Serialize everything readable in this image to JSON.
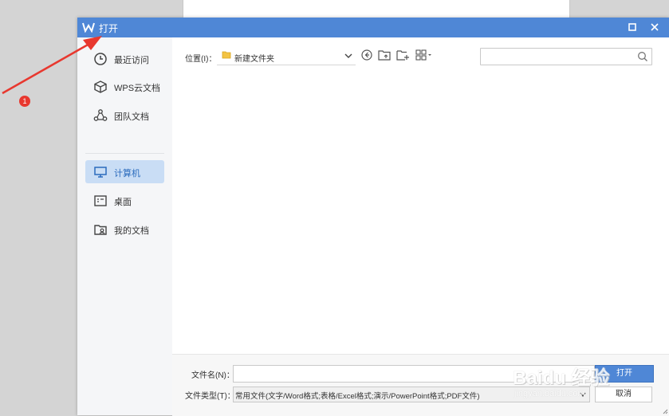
{
  "dialog": {
    "title": "打开",
    "title_icon": "wps-logo-icon",
    "buttons": {
      "maximize_icon": "maximize-icon",
      "close_icon": "close-icon"
    }
  },
  "sidebar": {
    "items": [
      {
        "label": "最近访问",
        "icon": "clock-icon",
        "active": false
      },
      {
        "label": "WPS云文档",
        "icon": "cloud-box-icon",
        "active": false
      },
      {
        "label": "团队文档",
        "icon": "team-icon",
        "active": false
      },
      {
        "label": "计算机",
        "icon": "computer-icon",
        "active": true
      },
      {
        "label": "桌面",
        "icon": "desktop-icon",
        "active": false
      },
      {
        "label": "我的文档",
        "icon": "my-documents-icon",
        "active": false
      }
    ]
  },
  "toolbar": {
    "location_label": "位置(I)：",
    "location_value": "新建文件夹",
    "tools": [
      "back-icon",
      "up-folder-icon",
      "new-folder-icon",
      "view-mode-icon"
    ],
    "search_placeholder": ""
  },
  "footer": {
    "filename_label": "文件名(N)：",
    "filename_value": "",
    "filetype_label": "文件类型(T)：",
    "filetype_value": "常用文件(文字/Word格式;表格/Excel格式;演示/PowerPoint格式;PDF文件)",
    "open_label": "打开",
    "cancel_label": "取消"
  },
  "annotation": {
    "badge": "1",
    "arrow_color": "#e8382f"
  },
  "watermark": {
    "line1": "Baidu 经验",
    "line2": "jingyan.baidu.com"
  },
  "colors": {
    "accent": "#4f87d6",
    "active_bg": "#c9ddf5",
    "sidebar_bg": "#f5f6f8"
  }
}
